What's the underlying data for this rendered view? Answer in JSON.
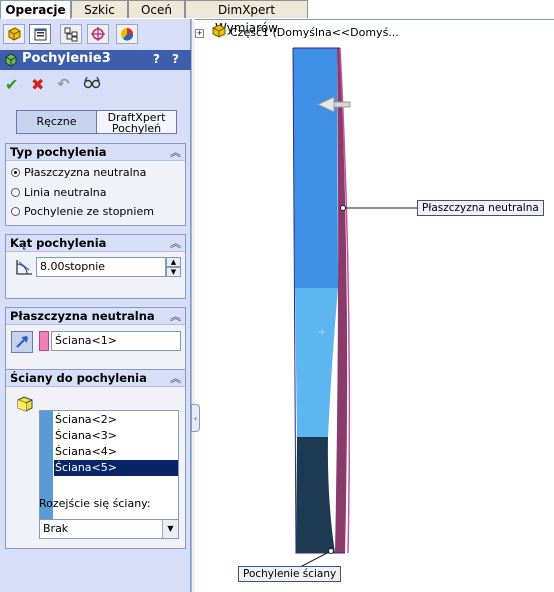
{
  "top_tabs": [
    "Operacje",
    "Szkic",
    "Oceń",
    "DimXpert Wymiarów"
  ],
  "panel_icons": [
    "feature-manager-icon",
    "property-manager-icon",
    "configuration-manager-icon",
    "dimxpert-manager-icon",
    "display-manager-icon"
  ],
  "feature": {
    "title": "Pochylenie3",
    "help_labels": [
      "?",
      "?"
    ],
    "ok_icon": "check-icon",
    "cancel_icon": "cancel-icon",
    "undo_icon": "undo-icon",
    "preview_icon": "detailed-preview-icon"
  },
  "mode_buttons": {
    "manual": "Ręczne",
    "draftxpert_line1": "DraftXpert",
    "draftxpert_line2": "Pochyleń"
  },
  "draft_type": {
    "title": "Typ pochylenia",
    "options": [
      {
        "label": "Płaszczyzna neutralna",
        "selected": true
      },
      {
        "label": "Linia neutralna",
        "selected": false
      },
      {
        "label": "Pochylenie ze stopniem",
        "selected": false
      }
    ]
  },
  "draft_angle": {
    "title": "Kąt pochylenia",
    "value": "8.00stopnie"
  },
  "neutral_plane": {
    "title": "Płaszczyzna neutralna",
    "value": "Ściana<1>",
    "swatch_color": "#f080b8"
  },
  "faces_to_draft": {
    "title": "Ściany do pochylenia",
    "items": [
      "Ściana<2>",
      "Ściana<3>",
      "Ściana<4>",
      "Ściana<5>"
    ],
    "selected_index": 3,
    "propagation_label": "Rozejście się ściany:",
    "propagation_value": "Brak"
  },
  "graphics": {
    "tree_label": "Część1  (Domyślna<<Domyś...",
    "callout_neutral_plane": "Płaszczyzna neutralna",
    "callout_draft_face": "Pochylenie ściany"
  },
  "colors": {
    "panel_bg": "#d6dff7",
    "title_bar": "#3d5eaa",
    "part_blue": "#3f8fe6",
    "part_light_blue": "#5db6f0",
    "part_dark": "#1e3a52",
    "draft_face": "#8a3b6a",
    "selection": "#0a246a"
  }
}
